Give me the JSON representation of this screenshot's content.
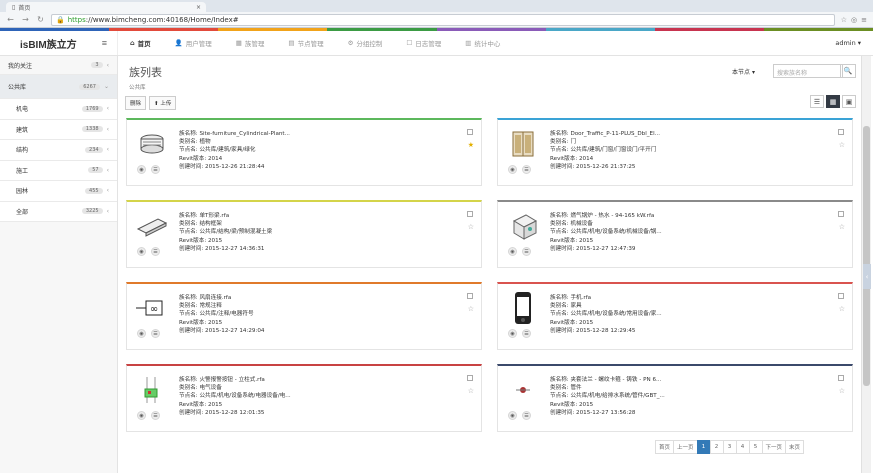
{
  "browser": {
    "tab_title": "首页",
    "url_scheme": "https",
    "url_rest": "://www.bimcheng.com:40168/Home/Index#",
    "rainbow": [
      "#2e64b8",
      "#e24a3b",
      "#f1a31a",
      "#3b9b44",
      "#8a5bb8",
      "#4aa7c7",
      "#c7344f",
      "#6b8e23"
    ]
  },
  "app": {
    "brand": "isBIM族立方",
    "admin": "admin"
  },
  "topnav": [
    {
      "label": "首页",
      "icon": "⌂",
      "active": true
    },
    {
      "label": "用户管理",
      "icon": "👤",
      "active": false
    },
    {
      "label": "族管理",
      "icon": "▦",
      "active": false
    },
    {
      "label": "节点管理",
      "icon": "▤",
      "active": false
    },
    {
      "label": "分组控制",
      "icon": "⚙",
      "active": false
    },
    {
      "label": "日志管理",
      "icon": "☐",
      "active": false
    },
    {
      "label": "统计中心",
      "icon": "▥",
      "active": false
    }
  ],
  "sidebar": {
    "top": {
      "label": "我的关注",
      "count": "3"
    },
    "group": {
      "label": "公共库",
      "count": "6267"
    },
    "items": [
      {
        "label": "机电",
        "count": "1769"
      },
      {
        "label": "建筑",
        "count": "1338"
      },
      {
        "label": "结构",
        "count": "234"
      },
      {
        "label": "施工",
        "count": "57"
      },
      {
        "label": "园林",
        "count": "455"
      },
      {
        "label": "全部",
        "count": "3225"
      }
    ]
  },
  "page": {
    "title": "族列表",
    "breadcrumb": "公共库",
    "sort_label": "本节点",
    "search_placeholder": "搜索族名称",
    "btn_delete": "删除",
    "btn_import": "上传"
  },
  "cards": [
    {
      "name": "族名称: Site-furniture_Cylindrical-Plant...",
      "category": "类别名: 植物",
      "node": "节点名: 公共库/建筑/家具/绿化",
      "revit": "Revit版本: 2014",
      "created": "创建时间: 2015-12-26 21:28:44",
      "accent": "#5cb85c",
      "starred": true,
      "thumb": "plant"
    },
    {
      "name": "族名称: Door_Traffic_P-11-PLUS_Dbl_El...",
      "category": "类别名: 门",
      "node": "节点名: 公共库/建筑/门窗/门窗设门/平开门",
      "revit": "Revit版本: 2014",
      "created": "创建时间: 2015-12-26 21:37:25",
      "accent": "#3aa3d6",
      "starred": false,
      "thumb": "door"
    },
    {
      "name": "族名称: 单T形梁.rfa",
      "category": "类别名: 结构框架",
      "node": "节点名: 公共库/结构/梁/预制混凝土梁",
      "revit": "Revit版本: 2015",
      "created": "创建时间: 2015-12-27 14:36:31",
      "accent": "#d4d44a",
      "starred": false,
      "thumb": "beam"
    },
    {
      "name": "族名称: 燃气锅炉 - 热水 - 94-165 kW.rfa",
      "category": "类别名: 机械设备",
      "node": "节点名: 公共库/机电/设备系统/机械设备/锅...",
      "revit": "Revit版本: 2015",
      "created": "创建时间: 2015-12-27 12:47:39",
      "accent": "#8a8a8a",
      "starred": false,
      "thumb": "boiler"
    },
    {
      "name": "族名称: 风扇连接.rfa",
      "category": "类别名: 常规注释",
      "node": "节点名: 公共库/注释/电器符号",
      "revit": "Revit版本: 2015",
      "created": "创建时间: 2015-12-27 14:29:04",
      "accent": "#e07a2b",
      "starred": false,
      "thumb": "symbol"
    },
    {
      "name": "族名称: 手机.rfa",
      "category": "类别名: 家具",
      "node": "节点名: 公共库/机电/设备系统/常用设备/家...",
      "revit": "Revit版本: 2015",
      "created": "创建时间: 2015-12-28 12:29:45",
      "accent": "#d9534f",
      "starred": false,
      "thumb": "phone"
    },
    {
      "name": "族名称: 火警报警按钮 - 立柱式.rfa",
      "category": "类别名: 电气设备",
      "node": "节点名: 公共库/机电/设备系统/电器设备/电...",
      "revit": "Revit版本: 2015",
      "created": "创建时间: 2015-12-28 12:01:35",
      "accent": "#c84343",
      "starred": false,
      "thumb": "alarm"
    },
    {
      "name": "族名称: 夹套法兰 - 螺纹卡箍 - 铸铁 - PN 6...",
      "category": "类别名: 管件",
      "node": "节点名: 公共库/机电/给排水系统/管件/GBT_...",
      "revit": "Revit版本: 2015",
      "created": "创建时间: 2015-12-27 13:56:28",
      "accent": "#3b4a6b",
      "starred": false,
      "thumb": "flange"
    }
  ],
  "pager": [
    "首页",
    "上一页",
    "1",
    "2",
    "3",
    "4",
    "5",
    "下一页",
    "末页"
  ],
  "pager_active": "1"
}
